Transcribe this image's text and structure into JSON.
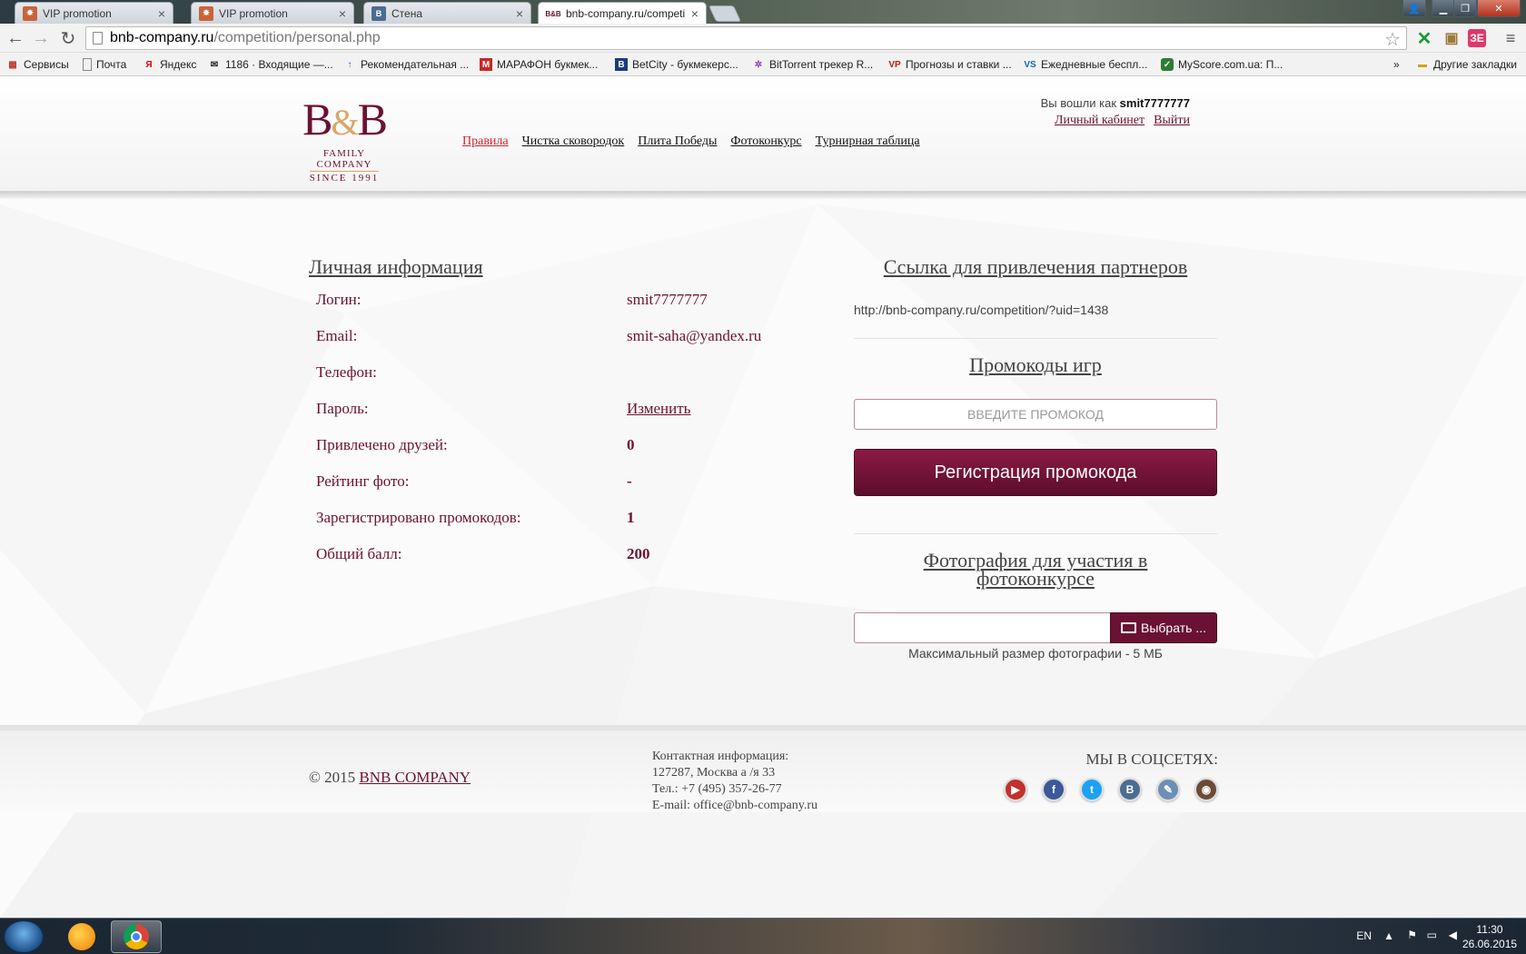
{
  "browser": {
    "tabs": [
      {
        "title": "VIP promotion",
        "close": "×"
      },
      {
        "title": "VIP promotion",
        "close": "×"
      },
      {
        "title": "Стена",
        "close": "×"
      },
      {
        "title": "bnb-company.ru/competi",
        "close": "×"
      }
    ],
    "url_host": "bnb-company.ru",
    "url_path": "/competition/personal.php",
    "bookmarks": [
      "Сервисы",
      "Почта",
      "Яндекс",
      "1186 · Входящие —...",
      "Рекомендательная ...",
      "МАРАФОН букмек...",
      "BetCity - букмекерс...",
      "BitTorrent трекер R...",
      "Прогнозы и ставки ...",
      "Ежедневные беспл...",
      "MyScore.com.ua: П..."
    ],
    "bookmarks_more": "»",
    "other_bookmarks": "Другие закладки"
  },
  "header": {
    "logo": {
      "mark_left": "B",
      "mark_amp": "&",
      "mark_right": "B",
      "line1": "FAMILY COMPANY",
      "line2": "SINCE 1991"
    },
    "nav": [
      "Правила",
      "Чистка сковородок",
      "Плита Победы",
      "Фотоконкурс",
      "Турнирная таблица"
    ],
    "logged_in_prefix": "Вы вошли как",
    "username": "smit7777777",
    "cabinet_link": "Личный кабинет",
    "logout_link": "Выйти"
  },
  "personal": {
    "title": "Личная информация",
    "rows": [
      {
        "label": "Логин:",
        "value": "smit7777777"
      },
      {
        "label": "Email:",
        "value": "smit-saha@yandex.ru"
      },
      {
        "label": "Телефон:",
        "value": ""
      },
      {
        "label": "Пароль:",
        "value": "Изменить"
      },
      {
        "label": "Привлечено друзей:",
        "value": "0"
      },
      {
        "label": "Рейтинг фото:",
        "value": "-"
      },
      {
        "label": "Зарегистрировано промокодов:",
        "value": "1"
      },
      {
        "label": "Общий балл:",
        "value": "200"
      }
    ]
  },
  "partners": {
    "title": "Ссылка для привлечения партнеров",
    "link": "http://bnb-company.ru/competition/?uid=1438"
  },
  "promo": {
    "title": "Промокоды игр",
    "placeholder": "ВВЕДИТЕ ПРОМОКОД",
    "button": "Регистрация промокода"
  },
  "photo": {
    "title_line1": "Фотография для участия в",
    "title_line2": "фотоконкурсе",
    "button": "Выбрать ...",
    "note": "Максимальный размер фотографии - 5 МБ"
  },
  "footer": {
    "copyright_prefix": "© 2015",
    "company": "BNB COMPANY",
    "contacts": [
      "Контактная информация:",
      "127287, Москва а /я 33",
      "Тел.: +7 (495) 357-26-77",
      "E-mail: office@bnb-company.ru"
    ],
    "social_title": "МЫ В СОЦСЕТЯХ:",
    "socials": [
      {
        "icon": "youtube-icon",
        "color": "#c4302b",
        "glyph": "▶"
      },
      {
        "icon": "facebook-icon",
        "color": "#3b5998",
        "glyph": "f"
      },
      {
        "icon": "twitter-icon",
        "color": "#1da1f2",
        "glyph": "t"
      },
      {
        "icon": "vk-icon",
        "color": "#4c6c91",
        "glyph": "B"
      },
      {
        "icon": "livejournal-icon",
        "color": "#6d8fb3",
        "glyph": "✎"
      },
      {
        "icon": "instagram-icon",
        "color": "#6d4a36",
        "glyph": "◉"
      }
    ]
  },
  "taskbar": {
    "lang": "EN",
    "time": "11:30",
    "date": "26.06.2015"
  },
  "colors": {
    "brand": "#6b1133",
    "accent_nav": "#d3232f",
    "gold": "#d8a867"
  }
}
